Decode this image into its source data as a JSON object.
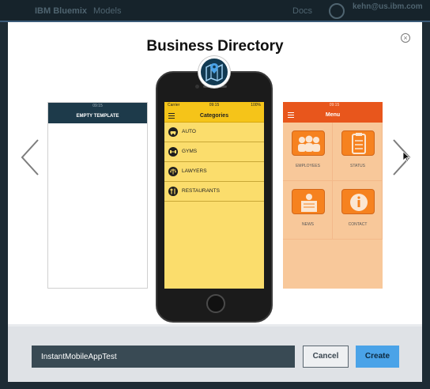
{
  "topbar": {
    "brand": "IBM Bluemix",
    "models_label": "Models",
    "docs_label": "Docs",
    "user_email": "kehn@us.ibm.com"
  },
  "modal": {
    "title": "Business Directory",
    "close_symbol": "×"
  },
  "left_template": {
    "time": "09:15",
    "header": "EMPTY TEMPLATE"
  },
  "center_template": {
    "carrier": "Carrier",
    "time": "09:15",
    "battery": "100%",
    "header": "Categories",
    "categories": [
      {
        "label": "AUTO",
        "icon": "car-icon"
      },
      {
        "label": "GYMS",
        "icon": "dumbbell-icon"
      },
      {
        "label": "LAWYERS",
        "icon": "scales-icon"
      },
      {
        "label": "RESTAURANTS",
        "icon": "cutlery-icon"
      }
    ]
  },
  "right_template": {
    "time": "09:15",
    "header": "Menu",
    "tiles": [
      {
        "label": "EMPLOYEES",
        "icon": "people-icon"
      },
      {
        "label": "STATUS",
        "icon": "clipboard-icon"
      },
      {
        "label": "NEWS",
        "icon": "newspaper-icon"
      },
      {
        "label": "CONTACT",
        "icon": "info-icon"
      }
    ]
  },
  "badge_icon": "map-pin-icon",
  "footer": {
    "app_name_value": "InstantMobileAppTest",
    "cancel_label": "Cancel",
    "create_label": "Create"
  },
  "colors": {
    "center_screen": "#fbdd6c",
    "center_header": "#f5c419",
    "right_header": "#e8561c",
    "right_body": "#f8c89a",
    "create_button": "#4aa3e8",
    "input_bg": "#394a54"
  }
}
